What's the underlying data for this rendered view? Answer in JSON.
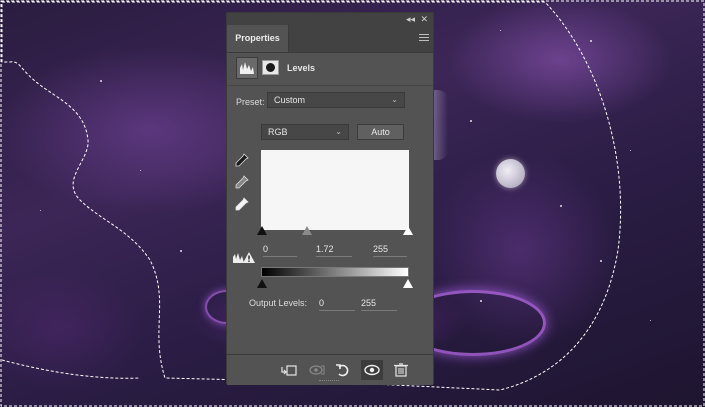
{
  "panel": {
    "tab_label": "Properties",
    "adjustment_title": "Levels",
    "preset_label": "Preset:",
    "preset_value": "Custom",
    "channel_value": "RGB",
    "auto_label": "Auto",
    "input_black": "0",
    "input_gamma": "1.72",
    "input_white": "255",
    "output_label": "Output Levels:",
    "output_black": "0",
    "output_white": "255",
    "collapse_glyph": "◂◂",
    "close_glyph": "✕"
  },
  "icons": [
    "levels-histogram-icon",
    "mask-icon",
    "black-point-eyedropper-icon",
    "gray-point-eyedropper-icon",
    "white-point-eyedropper-icon",
    "clipping-warning-icon",
    "clip-to-layer-icon",
    "view-previous-state-icon",
    "reset-icon",
    "visibility-eye-icon",
    "delete-icon"
  ],
  "colors": {
    "panel_bg": "#535353",
    "titlebar_bg": "#424242",
    "histogram_bg": "#f6f6f6"
  }
}
